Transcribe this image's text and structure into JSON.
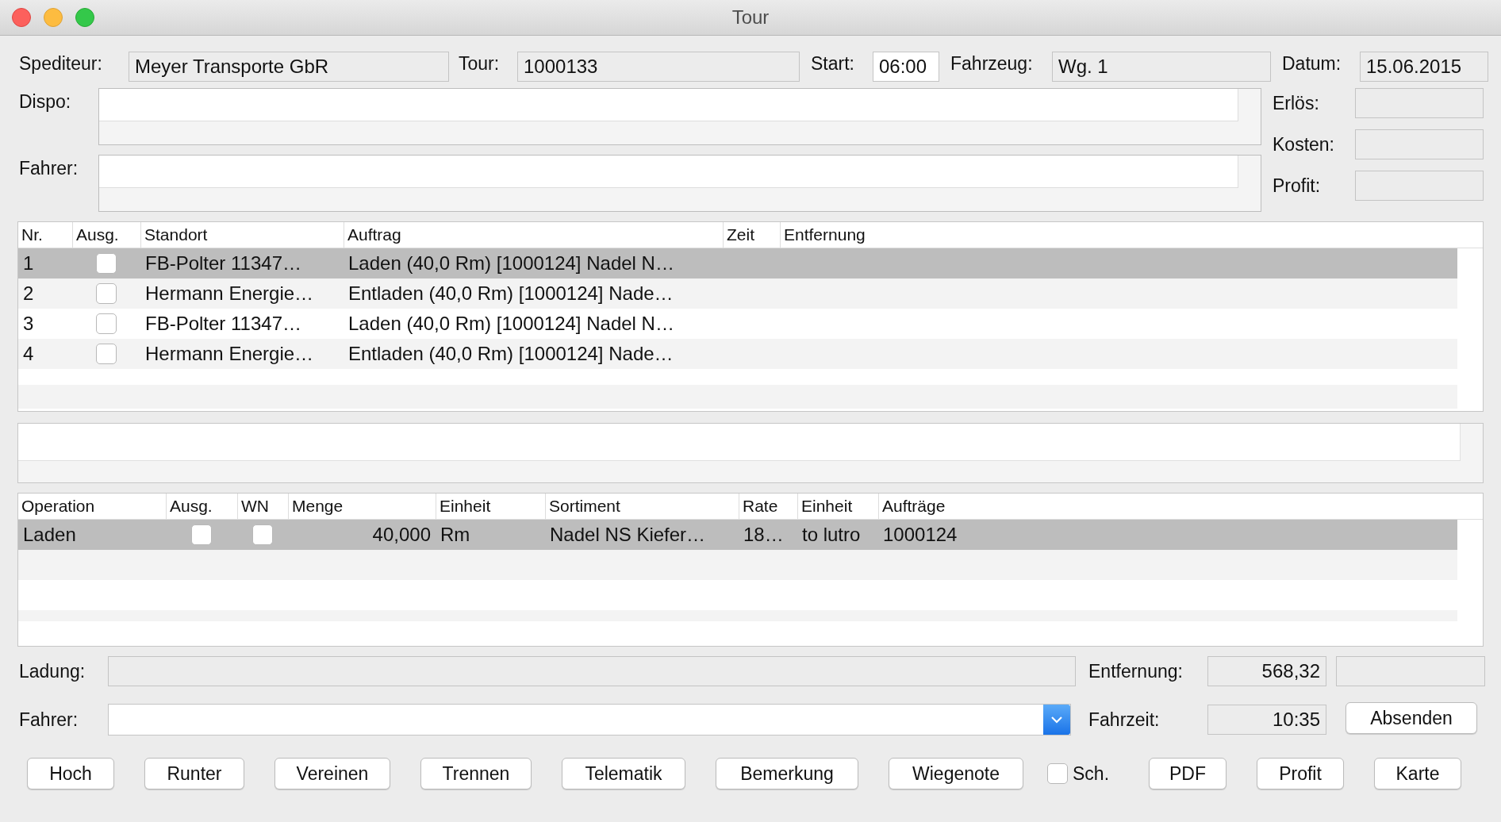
{
  "window": {
    "title": "Tour"
  },
  "top_fields": [
    {
      "label": "Spediteur:",
      "value": "Meyer Transporte GbR",
      "editable": false
    },
    {
      "label": "Tour:",
      "value": "1000133",
      "editable": false
    },
    {
      "label": "Start:",
      "value": "06:00",
      "editable": true
    },
    {
      "label": "Fahrzeug:",
      "value": "Wg. 1",
      "editable": false
    },
    {
      "label": "Datum:",
      "value": "15.06.2015",
      "editable": false
    }
  ],
  "notes": [
    {
      "label": "Dispo:"
    },
    {
      "label": "Fahrer:"
    }
  ],
  "summary": [
    {
      "label": "Erlös:"
    },
    {
      "label": "Kosten:"
    },
    {
      "label": "Profit:"
    }
  ],
  "stops": {
    "columns": [
      "Nr.",
      "Ausg.",
      "Standort",
      "Auftrag",
      "Zeit",
      "Entfernung"
    ],
    "rows": [
      {
        "nr": "1",
        "checked": false,
        "standort": "FB-Polter 11347…",
        "auftrag": "Laden (40,0 Rm) [1000124] Nadel N…",
        "selected": true
      },
      {
        "nr": "2",
        "checked": false,
        "standort": "Hermann Energie…",
        "auftrag": "Entladen (40,0 Rm) [1000124] Nade…",
        "selected": false
      },
      {
        "nr": "3",
        "checked": false,
        "standort": "FB-Polter 11347…",
        "auftrag": "Laden (40,0 Rm) [1000124] Nadel N…",
        "selected": false
      },
      {
        "nr": "4",
        "checked": false,
        "standort": "Hermann Energie…",
        "auftrag": "Entladen (40,0 Rm) [1000124] Nade…",
        "selected": false
      }
    ]
  },
  "operations": {
    "columns": [
      "Operation",
      "Ausg.",
      "WN",
      "Menge",
      "Einheit",
      "Sortiment",
      "Rate",
      "Einheit",
      "Aufträge"
    ],
    "rows": [
      {
        "operation": "Laden",
        "ausg": false,
        "wn": false,
        "menge": "40,000",
        "einheit": "Rm",
        "sortiment": "Nadel NS Kiefer…",
        "rate": "18…",
        "rate_einheit": "to lutro",
        "auftraege": "1000124",
        "selected": true
      }
    ]
  },
  "ladung": {
    "label": "Ladung:"
  },
  "entfernung": {
    "label": "Entfernung:",
    "value": "568,32"
  },
  "fahrer": {
    "label": "Fahrer:"
  },
  "fahrzeit": {
    "label": "Fahrzeit:",
    "value": "10:35"
  },
  "send_button": "Absenden",
  "actions": [
    {
      "kind": "button",
      "label": "Hoch"
    },
    {
      "kind": "button",
      "label": "Runter"
    },
    {
      "kind": "button",
      "label": "Vereinen"
    },
    {
      "kind": "button",
      "label": "Trennen"
    },
    {
      "kind": "button",
      "label": "Telematik"
    },
    {
      "kind": "button",
      "label": "Bemerkung"
    },
    {
      "kind": "button",
      "label": "Wiegenote"
    },
    {
      "kind": "checkbox",
      "label": "Sch.",
      "checked": false
    },
    {
      "kind": "button",
      "label": "PDF"
    },
    {
      "kind": "button",
      "label": "Profit"
    },
    {
      "kind": "button",
      "label": "Karte"
    }
  ]
}
